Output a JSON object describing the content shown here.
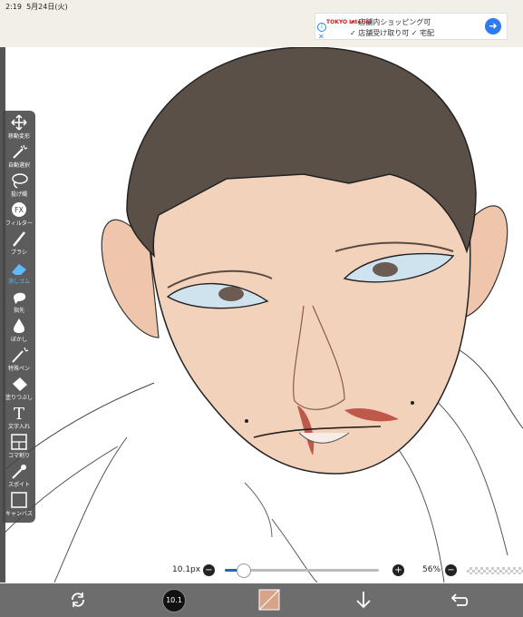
{
  "status_bar": {
    "time": "2:19",
    "date": "5月24日(火)"
  },
  "ad": {
    "logo": "TOKYO Interior",
    "line1": "✓ 店舗内ショッピング可",
    "line2": "✓ 店舗受け取り可  ✓ 宅配"
  },
  "tools": [
    {
      "label": "移動変形",
      "icon": "move-icon"
    },
    {
      "label": "自動選択",
      "icon": "magic-wand-icon"
    },
    {
      "label": "投げ縄",
      "icon": "lasso-icon"
    },
    {
      "label": "フィルター",
      "icon": "fx-icon"
    },
    {
      "label": "ブラシ",
      "icon": "brush-icon"
    },
    {
      "label": "消しゴム",
      "icon": "eraser-icon",
      "active": true
    },
    {
      "label": "指先",
      "icon": "finger-icon"
    },
    {
      "label": "ぼかし",
      "icon": "blur-drop-icon"
    },
    {
      "label": "特殊ペン",
      "icon": "special-pen-icon"
    },
    {
      "label": "塗りつぶし",
      "icon": "fill-icon"
    },
    {
      "label": "文字入れ",
      "icon": "text-icon"
    },
    {
      "label": "コマ割り",
      "icon": "frame-icon"
    },
    {
      "label": "スポイト",
      "icon": "eyedropper-icon"
    },
    {
      "label": "キャンバス",
      "icon": "canvas-icon"
    }
  ],
  "brush": {
    "size_label": "10.1px",
    "size_fraction": 0.12,
    "badge": "10.1"
  },
  "opacity": {
    "label": "56%"
  },
  "colors": {
    "active_tool": "#5eb9ff",
    "slider_fill": "#2a64b5",
    "bottom_bar": "#6d6d6d",
    "skin": "#f0cdb4",
    "hair": "#5a5048",
    "blood": "#b03a2e"
  }
}
